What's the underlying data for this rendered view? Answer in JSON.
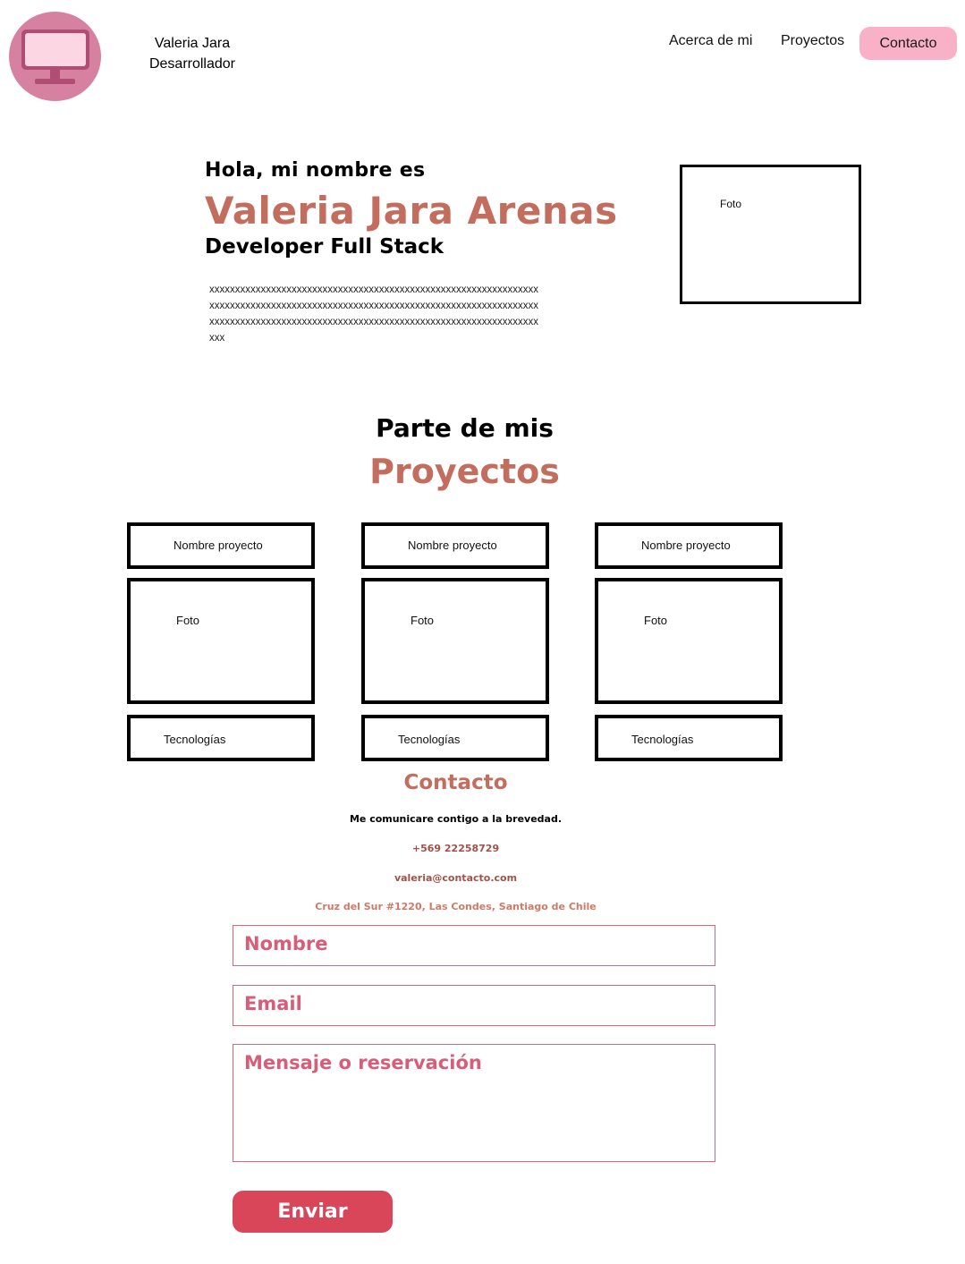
{
  "header": {
    "brand_name": "Valeria Jara",
    "brand_role": "Desarrollador",
    "nav": [
      "Acerca de mi",
      "Proyectos",
      "Contacto"
    ]
  },
  "hero": {
    "greeting": "Hola, mi nombre es",
    "name": "Valeria Jara Arenas",
    "role": "Developer Full Stack",
    "description": "xxxxxxxxxxxxxxxxxxxxxxxxxxxxxxxxxxxxxxxxxxxxxxxxxxxxxxxxxxxxxxxxxxxxxxxxxxxxxxxxxxxxxxxxxxxxxxxxxxxxxxxxxxxxxxxxxxxxxxxxxxxxxxxxxxxxxxxxxxxxxxxxxxxxxxxxxxxxxxxxxxxxxxxxxxxxxxxxxxxxxxxxxxxxxxxxxxx",
    "photo_label": "Foto"
  },
  "projects": {
    "intro": "Parte de mis",
    "title": "Proyectos",
    "items": [
      {
        "name": "Nombre proyecto",
        "photo": "Foto",
        "tech": "Tecnologías"
      },
      {
        "name": "Nombre proyecto",
        "photo": "Foto",
        "tech": "Tecnologías"
      },
      {
        "name": "Nombre proyecto",
        "photo": "Foto",
        "tech": "Tecnologías"
      }
    ]
  },
  "contact": {
    "title": "Contacto",
    "subtitle": "Me comunicare contigo a la brevedad.",
    "phone": "+569 22258729",
    "email": "valeria@contacto.com",
    "address": "Cruz del Sur #1220, Las Condes, Santiago de Chile",
    "form": {
      "name_placeholder": "Nombre",
      "email_placeholder": "Email",
      "message_placeholder": "Mensaje o reservación",
      "submit_label": "Enviar"
    }
  },
  "colors": {
    "accent": "#c26d5e",
    "nav_highlight": "#f9b1c8",
    "button": "#d9465a",
    "logo_bg": "#d6819f"
  },
  "icons": {
    "logo": "monitor-icon"
  }
}
